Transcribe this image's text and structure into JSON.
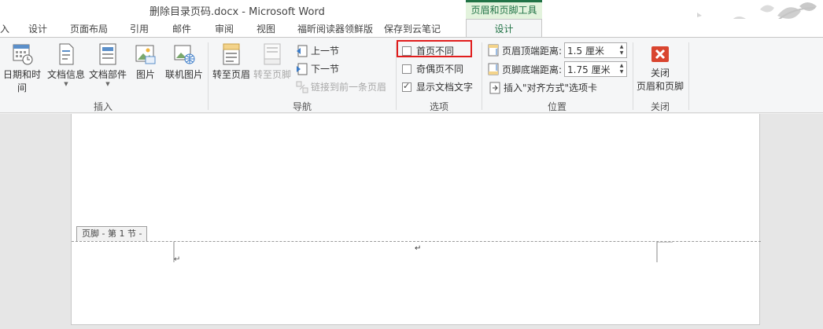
{
  "window": {
    "title": "删除目录页码.docx - Microsoft Word",
    "context_tab_header": "页眉和页脚工具"
  },
  "tabs": [
    {
      "label": "入"
    },
    {
      "label": "设计"
    },
    {
      "label": "页面布局"
    },
    {
      "label": "引用"
    },
    {
      "label": "邮件"
    },
    {
      "label": "审阅"
    },
    {
      "label": "视图"
    },
    {
      "label": "福昕阅读器领鲜版"
    },
    {
      "label": "保存到云笔记"
    },
    {
      "label": "设计"
    }
  ],
  "groups": {
    "insert": {
      "label": "插入",
      "buttons": [
        {
          "label": "日期和时间",
          "icon": "calendar-clock-icon"
        },
        {
          "label": "文档信息",
          "icon": "document-info-icon"
        },
        {
          "label": "文档部件",
          "icon": "document-parts-icon"
        },
        {
          "label": "图片",
          "icon": "picture-icon"
        },
        {
          "label": "联机图片",
          "icon": "online-picture-icon"
        }
      ]
    },
    "navigation": {
      "label": "导航",
      "goto_header": "转至页眉",
      "goto_footer": "转至页脚",
      "prev_section": "上一节",
      "next_section": "下一节",
      "link_previous": "链接到前一条页眉"
    },
    "options": {
      "label": "选项",
      "different_first_page": "首页不同",
      "different_odd_even": "奇偶页不同",
      "show_document_text": "显示文档文字"
    },
    "position": {
      "label": "位置",
      "header_from_top_label": "页眉顶端距离:",
      "header_from_top_value": "1.5 厘米",
      "footer_from_bottom_label": "页脚底端距离:",
      "footer_from_bottom_value": "1.75 厘米",
      "insert_alignment_tab": "插入\"对齐方式\"选项卡"
    },
    "close": {
      "label": "关闭",
      "close_button_line1": "关闭",
      "close_button_line2": "页眉和页脚"
    }
  },
  "document": {
    "footer_tag": "页脚 - 第 1 节 -",
    "paragraph_mark": "↵"
  },
  "colors": {
    "accent": "#217346",
    "highlight": "#e11d1d",
    "close_button": "#d9452f"
  }
}
